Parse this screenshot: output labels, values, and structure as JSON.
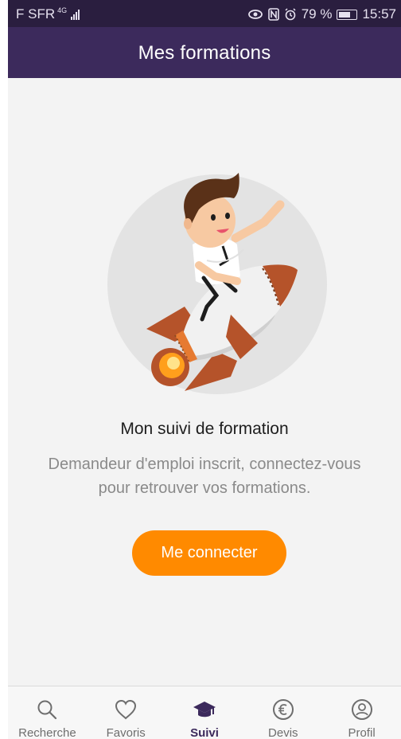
{
  "status_bar": {
    "carrier": "F SFR",
    "network": "4G",
    "battery_percent": "79 %",
    "time": "15:57"
  },
  "header": {
    "title": "Mes formations"
  },
  "main": {
    "illustration": "rocket-illustration",
    "heading": "Mon suivi de formation",
    "description_line1": "Demandeur d'emploi inscrit, connectez-vous",
    "description_line2": "pour retrouver vos formations.",
    "cta_label": "Me connecter"
  },
  "bottom_nav": {
    "items": [
      {
        "label": "Recherche",
        "icon": "search-icon",
        "active": false
      },
      {
        "label": "Favoris",
        "icon": "heart-icon",
        "active": false
      },
      {
        "label": "Suivi",
        "icon": "graduation-cap-icon",
        "active": true
      },
      {
        "label": "Devis",
        "icon": "euro-icon",
        "active": false
      },
      {
        "label": "Profil",
        "icon": "profile-icon",
        "active": false
      }
    ]
  },
  "colors": {
    "status_bar": "#2a1e3f",
    "header": "#3c2a5c",
    "cta": "#ff8a00",
    "background": "#f3f3f3",
    "nav_active": "#3c2a5c"
  }
}
